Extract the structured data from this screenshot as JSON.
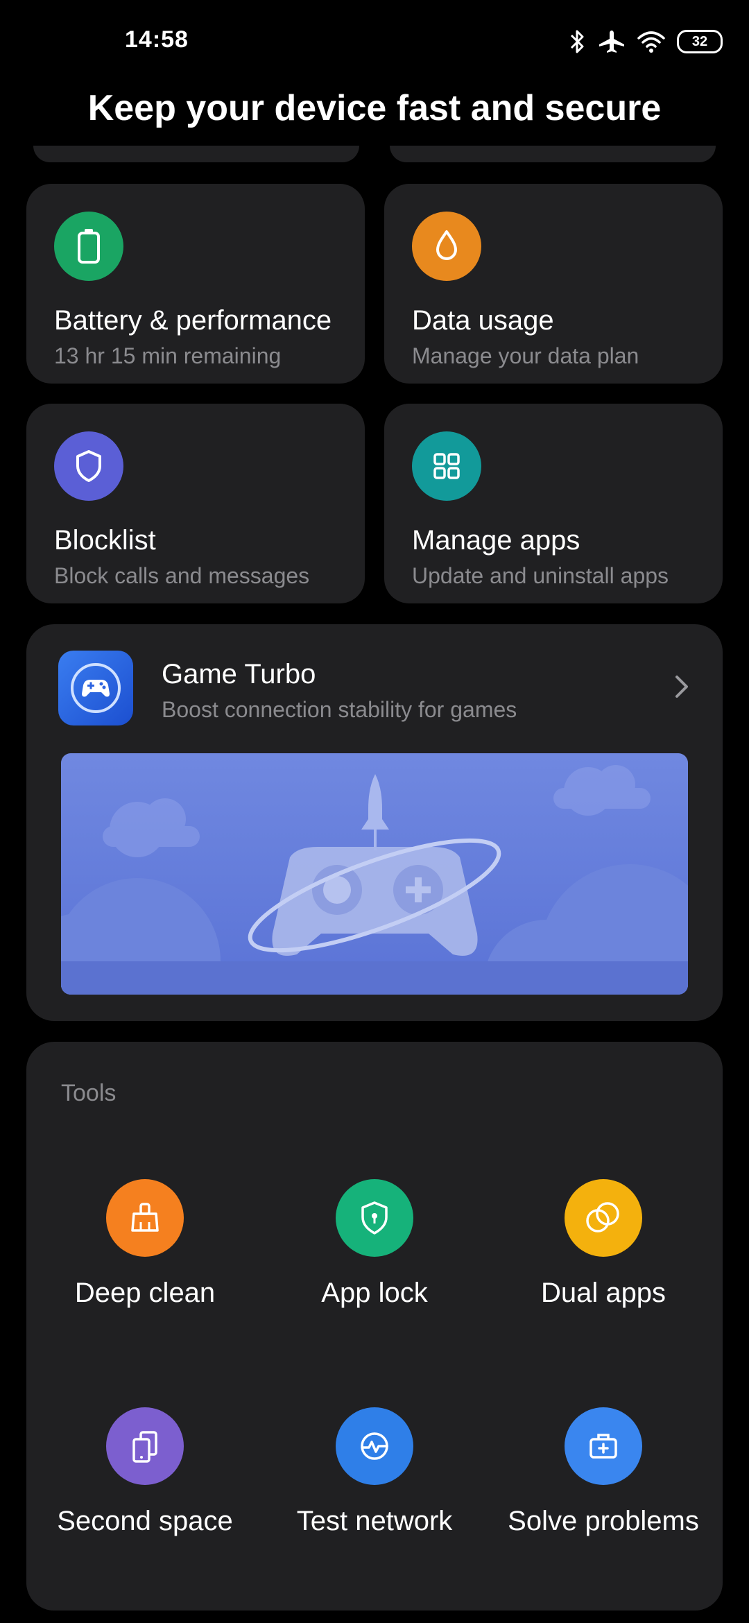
{
  "status": {
    "time": "14:58",
    "battery": "32"
  },
  "header": {
    "title": "Keep your device fast and secure"
  },
  "cards": [
    {
      "title": "Battery & performance",
      "subtitle": "13 hr 15 min  remaining",
      "icon": "battery-icon",
      "color": "#1aa563"
    },
    {
      "title": "Data usage",
      "subtitle": "Manage your data plan",
      "icon": "droplet-icon",
      "color": "#e8891e"
    },
    {
      "title": "Blocklist",
      "subtitle": "Block calls and messages",
      "icon": "shield-icon",
      "color": "#5b5fd6"
    },
    {
      "title": "Manage apps",
      "subtitle": "Update and uninstall apps",
      "icon": "grid-icon",
      "color": "#129a9a"
    }
  ],
  "game_turbo": {
    "title": "Game Turbo",
    "subtitle": "Boost connection stability for games",
    "icon": "gamepad-icon"
  },
  "tools": {
    "title": "Tools",
    "items": [
      {
        "label": "Deep clean",
        "icon": "broom-icon",
        "color": "#f5801f"
      },
      {
        "label": "App lock",
        "icon": "lock-shield-icon",
        "color": "#16b27a"
      },
      {
        "label": "Dual apps",
        "icon": "dual-circles-icon",
        "color": "#f4b10d"
      },
      {
        "label": "Second space",
        "icon": "second-space-icon",
        "color": "#7c5fcf"
      },
      {
        "label": "Test network",
        "icon": "network-test-icon",
        "color": "#2f7fe8"
      },
      {
        "label": "Solve problems",
        "icon": "toolbox-icon",
        "color": "#3a86ef"
      }
    ]
  }
}
